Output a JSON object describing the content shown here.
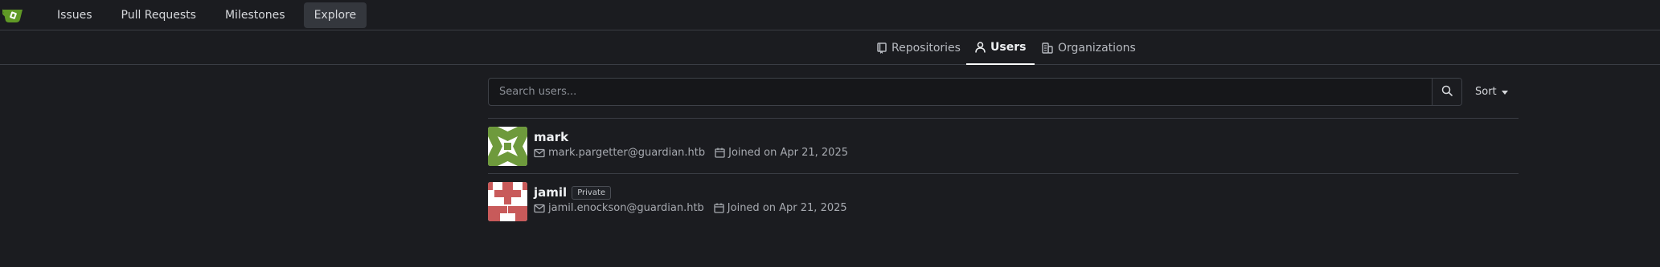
{
  "nav": {
    "items": [
      {
        "label": "Issues"
      },
      {
        "label": "Pull Requests"
      },
      {
        "label": "Milestones"
      },
      {
        "label": "Explore",
        "active": true
      }
    ]
  },
  "tabs": [
    {
      "label": "Repositories",
      "icon": "repo-icon"
    },
    {
      "label": "Users",
      "icon": "person-icon",
      "active": true
    },
    {
      "label": "Organizations",
      "icon": "organization-icon"
    }
  ],
  "search": {
    "placeholder": "Search users...",
    "value": "",
    "sort_label": "Sort"
  },
  "users": [
    {
      "name": "mark",
      "badge": "",
      "email": "mark.pargetter@guardian.htb",
      "joined": "Joined on Apr 21, 2025",
      "avatar_color": "#6e9a3c"
    },
    {
      "name": "jamil",
      "badge": "Private",
      "email": "jamil.enockson@guardian.htb",
      "joined": "Joined on Apr 21, 2025",
      "avatar_color": "#c85a5a"
    }
  ],
  "colors": {
    "background": "#1b1c20",
    "border": "#3a3d44",
    "logo": "#609926"
  }
}
